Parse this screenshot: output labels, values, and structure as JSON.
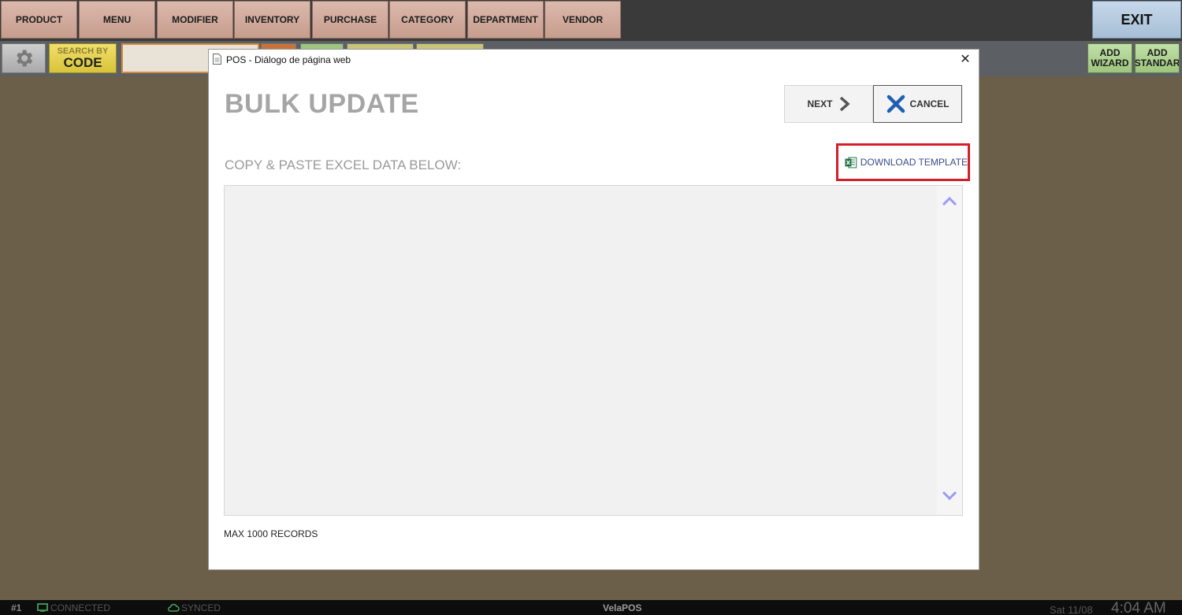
{
  "nav": {
    "items": [
      "PRODUCT",
      "MENU",
      "MODIFIER",
      "INVENTORY",
      "PURCHASE",
      "CATEGORY",
      "DEPARTMENT",
      "VENDOR"
    ],
    "exit_label": "EXIT"
  },
  "toolbar": {
    "search_by_label": "SEARCH BY",
    "search_by_value": "CODE",
    "add_wizard": [
      "ADD",
      "WIZARD"
    ],
    "add_standard": [
      "ADD",
      "STANDAR"
    ]
  },
  "dialog": {
    "window_title": "POS - Diálogo de página web",
    "close_symbol": "✕",
    "title": "BULK UPDATE",
    "next_label": "NEXT",
    "cancel_label": "CANCEL",
    "section_label": "COPY & PASTE EXCEL DATA BELOW:",
    "download_label": "DOWNLOAD TEMPLATE",
    "footnote": "MAX 1000 RECORDS"
  },
  "statusbar": {
    "terminal": "#1",
    "connection": "CONNECTED",
    "sync": "SYNCED",
    "app_name": "VelaPOS",
    "date": "Sat 11/08",
    "time": "4:04 AM"
  },
  "colors": {
    "background": "#6b5f49",
    "nav_button": "#c79d8d",
    "exit_button": "#a7bfd6",
    "search_by": "#d8c33a",
    "add_button": "#9dc57e",
    "highlight_border": "#d41f2a",
    "cancel_icon": "#1f5fb0",
    "excel_icon": "#1e7145"
  }
}
